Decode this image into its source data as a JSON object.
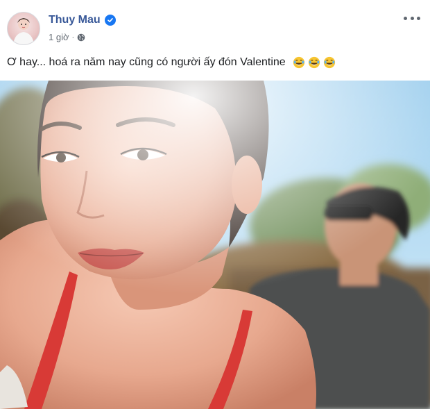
{
  "post": {
    "author": "Thuy Mau",
    "time": "1 giờ",
    "separator": "·",
    "caption": "Ơ hay... hoá ra năm nay cũng có người ấy đón Valentine",
    "emoji": [
      "laughing-tears-emoji",
      "laughing-tears-emoji",
      "laughing-tears-emoji"
    ]
  },
  "colors": {
    "author_link": "#385898",
    "verified_badge": "#1877f2",
    "meta_text": "#606770",
    "caption_text": "#1c1e21"
  }
}
